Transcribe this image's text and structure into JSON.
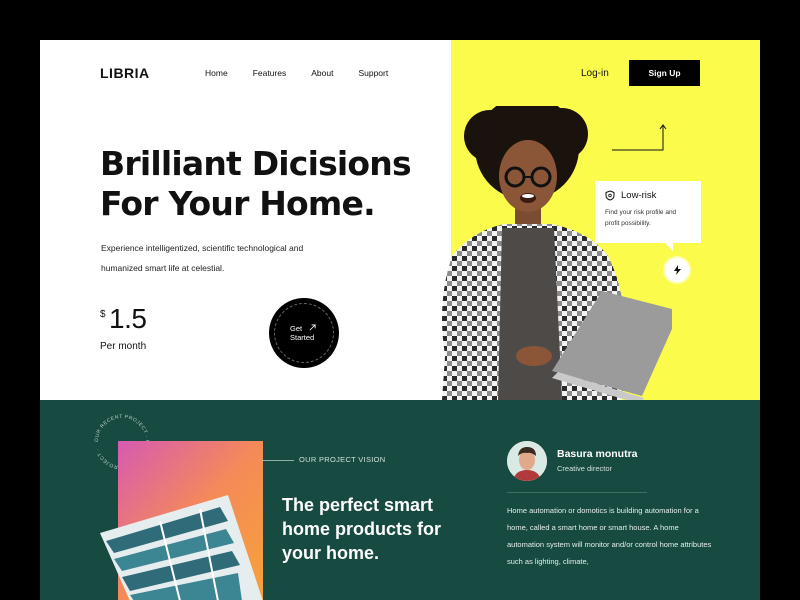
{
  "brand": {
    "name": "LIBRIA"
  },
  "nav": {
    "items": [
      "Home",
      "Features",
      "About",
      "Support"
    ],
    "login_label": "Log-in",
    "signup_label": "Sign Up"
  },
  "hero": {
    "headline_line1": "Brilliant Dicisions",
    "headline_line2": "For Your Home.",
    "subcopy": "Experience intelligentized, scientific technological and humanized smart life at celestial.",
    "price_currency": "$",
    "price_value": "1.5",
    "price_period": "Per month",
    "cta_label": "Get Started",
    "cta_icon": "arrow-up-right-icon"
  },
  "risk_card": {
    "title": "Low-risk",
    "text": "Find your risk profile and profit possibility.",
    "icon": "shield-icon"
  },
  "badge": {
    "icon": "lightning-icon"
  },
  "bottom": {
    "vision_label": "OUR PROJECT VISION",
    "headline": "The perfect smart home products for your home.",
    "circular_text": "OUR RECENT PROJECT · OUR RECENT PROJECT ·",
    "author_name": "Basura monutra",
    "author_role": "Creative director",
    "bio": "Home automation or domotics is building automation for a home, called a smart home or smart house. A home automation system will monitor and/or control home attributes such as lighting, climate,"
  },
  "colors": {
    "yellow": "#fbfb4b",
    "dark_green": "#174a40",
    "black": "#000000"
  }
}
